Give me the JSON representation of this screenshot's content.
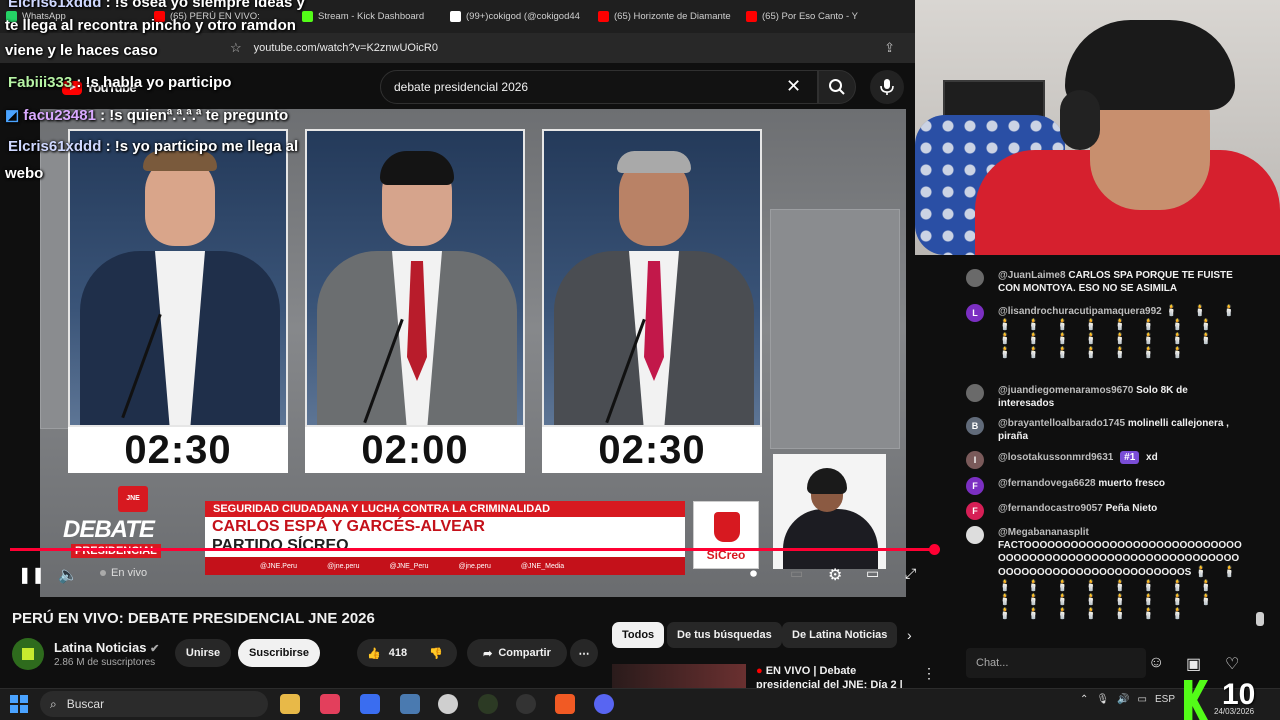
{
  "browser": {
    "tabs": [
      {
        "label": "WhatsApp",
        "color": "#25d366"
      },
      {
        "label": "(65) PERÚ EN VIVO:",
        "color": "#ff0000"
      },
      {
        "label": "Stream - Kick Dashboard",
        "color": "#53fc18"
      },
      {
        "label": "(99+)cokigod (@cokigod44",
        "color": "#ffffff"
      },
      {
        "label": "(65) Horizonte de Diamante",
        "color": "#ff0000"
      },
      {
        "label": "(65) Por Eso Canto - Y",
        "color": "#ff0000"
      }
    ],
    "url": "youtube.com/watch?v=K2znwUOicR0"
  },
  "youtube": {
    "logo": "YouTube",
    "search_value": "debate presidencial 2026"
  },
  "overlay_chat": [
    {
      "user": "Elcris61xddd",
      "text": ": !s osea yo siempre ideas y"
    },
    {
      "user": "",
      "text": "te llega al recontra pincho y otro ramdon"
    },
    {
      "user": "",
      "text": "viene y le haces caso"
    },
    {
      "user": "Fabiii333",
      "text": ": !s habla yo participo"
    },
    {
      "user": "facu23481",
      "text": ": !s quienª.ª.ª.ª te pregunto"
    },
    {
      "user": "Elcris61xddd",
      "text": ": !s yo participo me llega al"
    },
    {
      "user": "",
      "text": "webo"
    }
  ],
  "video": {
    "timers": [
      "02:30",
      "02:00",
      "02:30"
    ],
    "logo_badge": "JNE",
    "logo_line1": "DEBATE",
    "logo_line2": "PRESIDENCIAL",
    "topic": "SEGURIDAD CIUDADANA Y LUCHA CONTRA LA CRIMINALIDAD",
    "candidate_name": "CARLOS ESPÁ Y GARCÉS-ALVEAR",
    "party": "PARTIDO SÍCREO",
    "party_logo_text": "SíCreo",
    "socials": [
      "@JNE.Peru",
      "@jne.peru",
      "@JNE_Peru",
      "@jne.peru",
      "@JNE_Media"
    ],
    "live_label": "En vivo",
    "progress": 1.0
  },
  "video_info": {
    "title": "PERÚ EN VIVO: DEBATE PRESIDENCIAL JNE 2026",
    "channel": "Latina Noticias",
    "subscribers": "2.86 M de suscriptores",
    "join_label": "Unirse",
    "subscribe_label": "Suscribirse",
    "likes": "418",
    "share_label": "Compartir"
  },
  "recommendations": {
    "chips": [
      "Todos",
      "De tus búsquedas",
      "De Latina Noticias"
    ],
    "item_title": "EN VIVO | Debate presidencial del JNE: Día 2 |"
  },
  "chat": {
    "messages": [
      {
        "user": "@JuanLaime8",
        "text": "CARLOS SPA PORQUE TE FUISTE CON MONTOYA. ESO NO SE ASIMILA",
        "avatar": "",
        "avatar_color": "#6a6a6a"
      },
      {
        "user": "@lisandrochuracutipamaquera992",
        "text": "🕯️ 🕯️ 🕯️ 🕯️ 🕯️ 🕯️ 🕯️ 🕯️ 🕯️ 🕯️ 🕯️ 🕯️ 🕯️ 🕯️ 🕯️ 🕯️ 🕯️ 🕯️ 🕯️ 🕯️ 🕯️ 🕯️ 🕯️ 🕯️ 🕯️ 🕯️",
        "avatar": "L",
        "avatar_color": "#7b2fc2"
      },
      {
        "user": "@juandiegomenaramos9670",
        "text": "Solo 8K de interesados",
        "avatar": "",
        "avatar_color": "#6a6a6a"
      },
      {
        "user": "@brayantelloalbarado1745",
        "text": "molinelli callejonera , piraña",
        "avatar": "B",
        "avatar_color": "#616b7a"
      },
      {
        "user": "@losotakussonmrd9631",
        "text": "xd",
        "badge": "#1",
        "avatar": "I",
        "avatar_color": "#7a5a5a"
      },
      {
        "user": "@fernandovega6628",
        "text": "muerto fresco",
        "avatar": "F",
        "avatar_color": "#7b2fc2"
      },
      {
        "user": "@fernandocastro9057",
        "text": "Peña Nieto",
        "avatar": "F",
        "avatar_color": "#d61f56"
      },
      {
        "user": "@Megabananasplit",
        "text": "FACTOOOOOOOOOOOOOOOOOOOOOOOOOOOOOOOOOOOOOOOOOOOOOOOOOOOOOOOOOOOOOOOOOOOOOOOOOOOOOOOOOOOS",
        "candles": "🕯️ 🕯️ 🕯️ 🕯️ 🕯️ 🕯️ 🕯️ 🕯️ 🕯️ 🕯️ 🕯️ 🕯️ 🕯️ 🕯️ 🕯️ 🕯️ 🕯️ 🕯️ 🕯️ 🕯️ 🕯️ 🕯️ 🕯️ 🕯️ 🕯️",
        "avatar": "",
        "avatar_color": "#dddddd"
      }
    ],
    "input_placeholder": "Chat..."
  },
  "taskbar": {
    "search_placeholder": "Buscar",
    "lang": "ESP",
    "date": "24/03/2026",
    "kick_count": "10"
  }
}
